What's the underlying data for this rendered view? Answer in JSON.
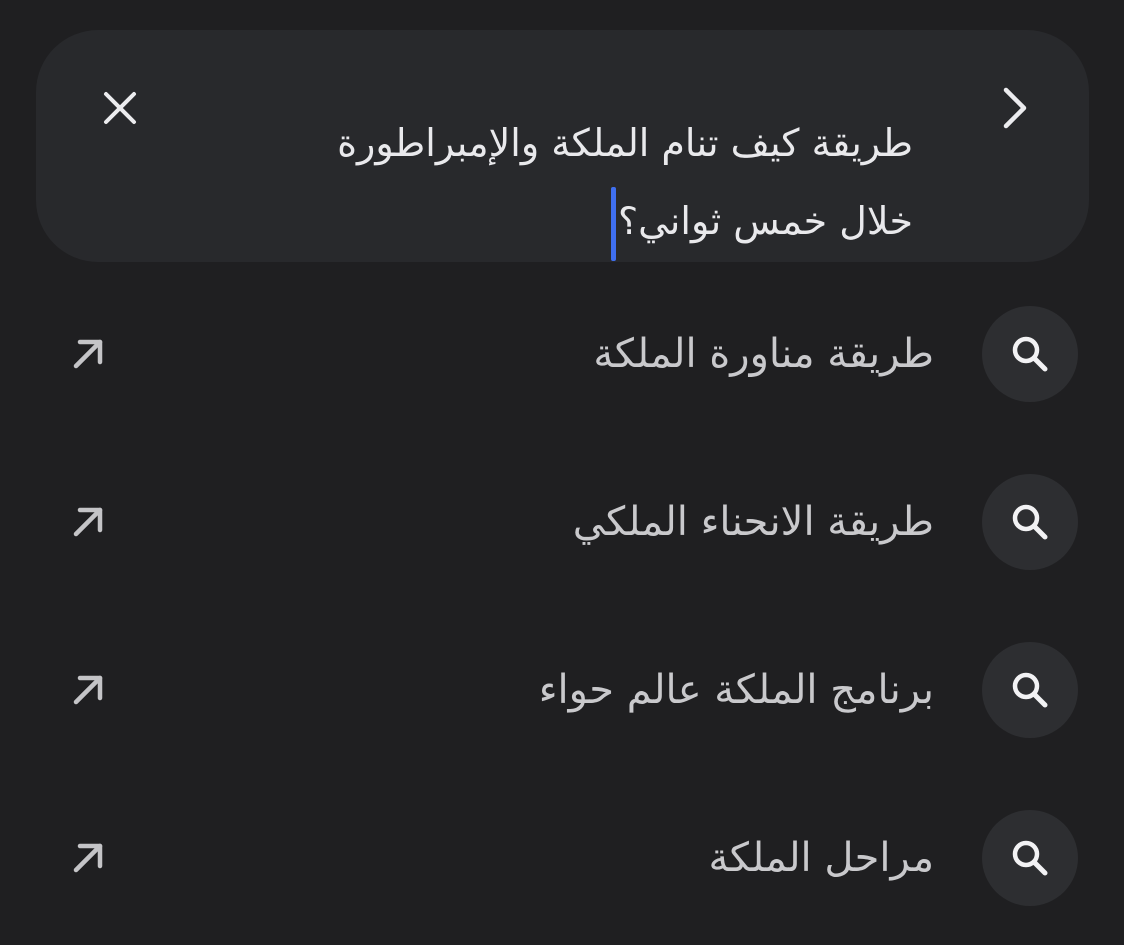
{
  "search": {
    "query_line1": "طريقة كيف تنام الملكة والإمبراطورة",
    "query_line2": "خلال خمس ثواني؟",
    "back_icon": "chevron-right-icon",
    "clear_icon": "close-icon",
    "caret_color": "#3f6ff0"
  },
  "suggestions": [
    {
      "label": "طريقة مناورة الملكة",
      "icon": "search-icon",
      "action_icon": "arrow-up-left-icon"
    },
    {
      "label": "طريقة الانحناء الملكي",
      "icon": "search-icon",
      "action_icon": "arrow-up-left-icon"
    },
    {
      "label": "برنامج الملكة عالم حواء",
      "icon": "search-icon",
      "action_icon": "arrow-up-left-icon"
    },
    {
      "label": "مراحل الملكة",
      "icon": "search-icon",
      "action_icon": "arrow-up-left-icon"
    }
  ],
  "colors": {
    "background": "#1f1f21",
    "search_box": "#28292c",
    "icon_circle": "#2d2e31",
    "text_primary": "#e9e9ec",
    "text_secondary": "#c9c9cc"
  }
}
